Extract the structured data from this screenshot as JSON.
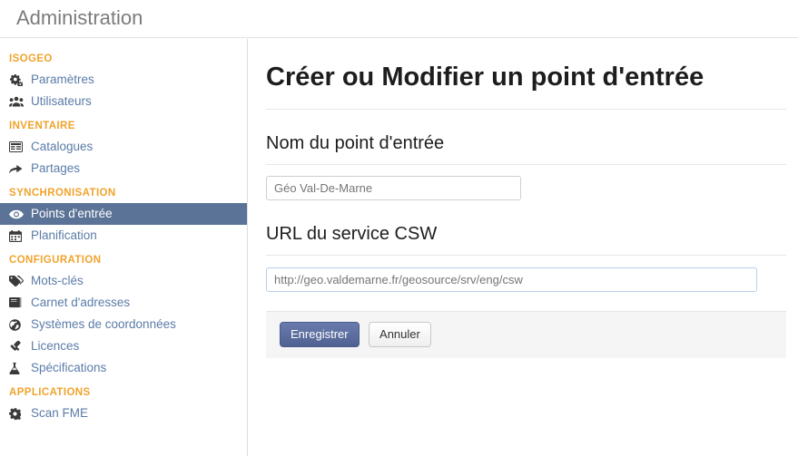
{
  "header": {
    "brand": "Administration"
  },
  "sidebar": {
    "sections": [
      {
        "title": "ISOGEO",
        "items": [
          {
            "label": "Paramètres",
            "icon": "gears-icon",
            "active": false
          },
          {
            "label": "Utilisateurs",
            "icon": "users-icon",
            "active": false
          }
        ]
      },
      {
        "title": "INVENTAIRE",
        "items": [
          {
            "label": "Catalogues",
            "icon": "table-icon",
            "active": false
          },
          {
            "label": "Partages",
            "icon": "share-arrow-icon",
            "active": false
          }
        ]
      },
      {
        "title": "SYNCHRONISATION",
        "items": [
          {
            "label": "Points d'entrée",
            "icon": "eye-icon",
            "active": true
          },
          {
            "label": "Planification",
            "icon": "calendar-icon",
            "active": false
          }
        ]
      },
      {
        "title": "CONFIGURATION",
        "items": [
          {
            "label": "Mots-clés",
            "icon": "tags-icon",
            "active": false
          },
          {
            "label": "Carnet d'adresses",
            "icon": "book-icon",
            "active": false
          },
          {
            "label": "Systèmes de coordonnées",
            "icon": "globe-icon",
            "active": false
          },
          {
            "label": "Licences",
            "icon": "gavel-icon",
            "active": false
          },
          {
            "label": "Spécifications",
            "icon": "flask-icon",
            "active": false
          }
        ]
      },
      {
        "title": "APPLICATIONS",
        "items": [
          {
            "label": "Scan FME",
            "icon": "gear-icon",
            "active": false
          }
        ]
      }
    ]
  },
  "main": {
    "page_title": "Créer ou Modifier un point d'entrée",
    "name_field": {
      "label": "Nom du point d'entrée",
      "value": "",
      "placeholder": "Géo Val-De-Marne"
    },
    "url_field": {
      "label": "URL du service CSW",
      "value": "",
      "placeholder": "http://geo.valdemarne.fr/geosource/srv/eng/csw"
    },
    "actions": {
      "save_label": "Enregistrer",
      "cancel_label": "Annuler"
    }
  },
  "colors": {
    "accent_orange": "#f0a32c",
    "link_blue": "#5b7ba8",
    "active_bg": "#5b7397",
    "primary_button": "#5b6d9e"
  }
}
